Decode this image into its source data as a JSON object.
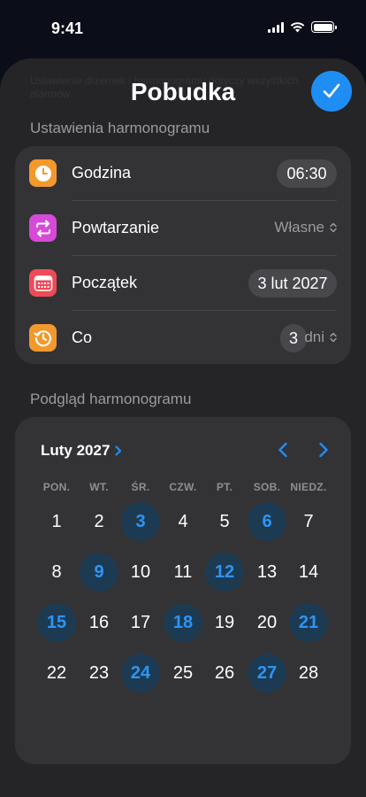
{
  "status": {
    "time": "9:41"
  },
  "sheet": {
    "ghost_text": "Ustawienie drzemek i harmonogramu dotyczy wszystkich alarmów",
    "title": "Pobudka",
    "confirm_icon": "checkmark-icon"
  },
  "schedule": {
    "label": "Ustawienia harmonogramu",
    "rows": [
      {
        "label": "Godzina",
        "value": "06:30",
        "icon": "clock-icon",
        "color": "#f2992e"
      },
      {
        "label": "Powtarzanie",
        "value": "Własne",
        "icon": "repeat-icon",
        "color": "#d64ad8"
      },
      {
        "label": "Początek",
        "value": "3 lut 2027",
        "icon": "calendar-icon",
        "color": "#ee4a58"
      },
      {
        "label": "Co",
        "value": "3",
        "unit": "dni",
        "icon": "history-icon",
        "color": "#f2992e"
      }
    ]
  },
  "preview": {
    "label": "Podgląd harmonogramu",
    "month": "Luty 2027",
    "weekdays": [
      "PON.",
      "WT.",
      "ŚR.",
      "CZW.",
      "PT.",
      "SOB.",
      "NIEDZ."
    ],
    "weeks": [
      [
        "1",
        "2",
        "3",
        "4",
        "5",
        "6",
        "7"
      ],
      [
        "8",
        "9",
        "10",
        "11",
        "12",
        "13",
        "14"
      ],
      [
        "15",
        "16",
        "17",
        "18",
        "19",
        "20",
        "21"
      ],
      [
        "22",
        "23",
        "24",
        "25",
        "26",
        "27",
        "28"
      ]
    ],
    "highlighted_days": [
      "3",
      "6",
      "9",
      "12",
      "15",
      "18",
      "21",
      "24",
      "27"
    ]
  },
  "colors": {
    "accent": "#1e8ef5",
    "highlight_bg": "#1d3a53",
    "highlight_text": "#2d95f5"
  }
}
